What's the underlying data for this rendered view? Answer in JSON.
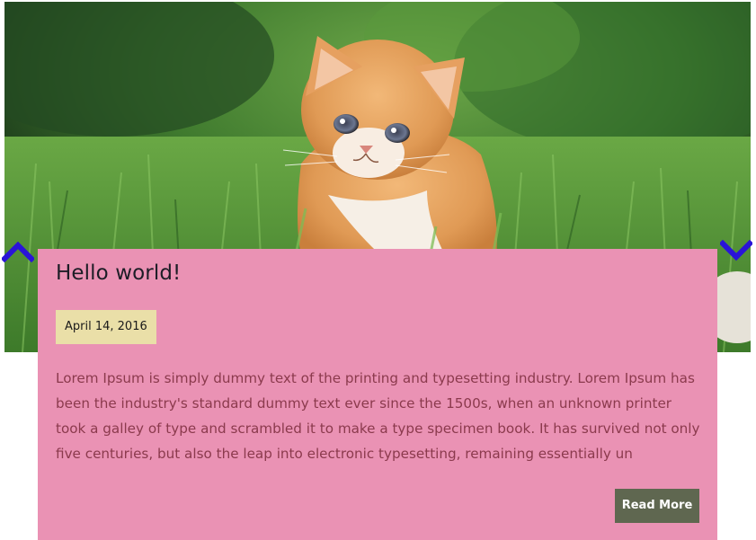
{
  "slider": {
    "prev_icon": "chevron-up-icon",
    "next_icon": "chevron-down-icon",
    "arrow_color": "#2a14d8"
  },
  "hero": {
    "image_subject": "kitten-in-grass"
  },
  "post": {
    "title": "Hello world!",
    "date": "April 14, 2016",
    "excerpt": "Lorem Ipsum is simply dummy text of the printing and typesetting industry. Lorem Ipsum has been the industry's standard dummy text ever since the 1500s, when an unknown printer took a galley of type and scrambled it to make a type specimen book. It has survived not only five centuries, but also the leap into electronic typesetting, remaining essentially un",
    "read_more_label": "Read More"
  },
  "colors": {
    "card_background": "#ea92b4",
    "date_badge_background": "#eadfa8",
    "excerpt_text": "#8b3a4d",
    "button_background": "#5f6750",
    "title_text": "#1d1d26"
  }
}
